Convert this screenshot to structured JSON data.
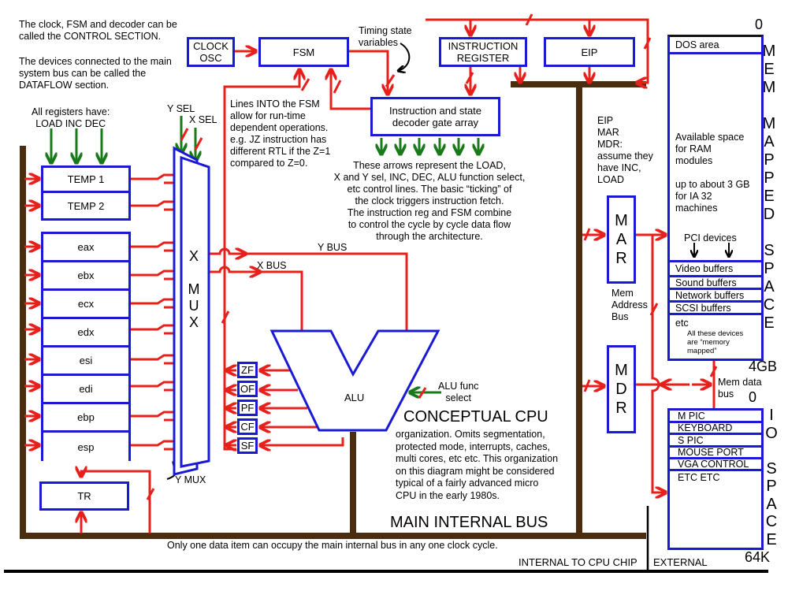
{
  "title": "Conceptual CPU organization diagram",
  "notes": {
    "control_section": "The clock, FSM and decoder can be\ncalled the CONTROL SECTION.",
    "dataflow_section": "The devices connected to the main\nsystem bus can be called the\nDATAFLOW section.",
    "registers_have": "All registers have:\nLOAD  INC  DEC",
    "fsm_lines": "Lines INTO the FSM\nallow for run-time\ndependent operations.\ne.g. JZ instruction has\ndifferent RTL if the Z=1\ncompared to Z=0.",
    "timing_state": "Timing state\nvariables",
    "control_arrows": "These arrows represent the LOAD,\nX and Y sel, INC, DEC, ALU function select,\netc control lines. The basic “ticking” of\nthe clock triggers instruction fetch.\nThe instruction reg and FSM combine\nto control the cycle by cycle data flow\nthrough the architecture.",
    "eip_mar_mdr": "EIP\nMAR\nMDR:\nassume they\nhave INC,\nLOAD",
    "mem_address_bus": "Mem\nAddress\nBus",
    "mem_data_bus": "Mem data\nbus",
    "conceptual_cpu_title": "CONCEPTUAL CPU",
    "conceptual_cpu_body": "organization. Omits segmentation,\nprotected  mode, interrupts, caches,\nmulti cores, etc etc. This organization\non this diagram might be considered\ntypical of a fairly advanced micro\nCPU in the early 1980s.",
    "main_internal_bus": "MAIN INTERNAL BUS",
    "bus_note": "Only one data item can occupy the main internal bus in any one clock cycle.",
    "internal_label": "INTERNAL TO CPU CHIP",
    "external_label": "EXTERNAL"
  },
  "control": {
    "clock": "CLOCK\nOSC",
    "fsm": "FSM",
    "instruction_register": "INSTRUCTION\nREGISTER",
    "eip": "EIP",
    "decoder": "Instruction and state\ndecoder gate array"
  },
  "mux": {
    "y_sel": "Y SEL",
    "x_sel": "X SEL",
    "label": "X\n\nM\nU\nX",
    "y_mux": "Y MUX",
    "x_bus": "X BUS",
    "y_bus": "Y BUS"
  },
  "registers": {
    "temp": [
      "TEMP 1",
      "TEMP 2"
    ],
    "general": [
      "eax",
      "ebx",
      "ecx",
      "edx",
      "esi",
      "edi",
      "ebp",
      "esp"
    ],
    "tr": "TR"
  },
  "alu": {
    "label": "ALU",
    "func_select": "ALU func\nselect",
    "flags": [
      "ZF",
      "OF",
      "PF",
      "CF",
      "SF"
    ]
  },
  "mem_regs": {
    "mar": "M\nA\nR",
    "mdr": "M\nD\nR"
  },
  "memory_map": {
    "start": "0",
    "end": "4GB",
    "side_label": "M\nE\nM\n\nM\nA\nP\nP\nE\nD\n\nS\nP\nA\nC\nE",
    "dos_area": "DOS area",
    "ram_text": "Available space\nfor RAM\nmodules\n\nup to about 3 GB\nfor IA 32\nmachines",
    "pci_devices": "PCI devices",
    "buffers": [
      "Video buffers",
      "Sound buffers",
      "Network buffers",
      "SCSI buffers"
    ],
    "etc": "etc",
    "etc_note": "All these devices\nare “memory\nmapped”"
  },
  "io_map": {
    "start": "0",
    "end": "64K",
    "side_label": "I\nO\n\nS\nP\nA\nC\nE",
    "ports": [
      "M PIC",
      "KEYBOARD",
      "S PIC",
      "MOUSE PORT",
      "VGA CONTROL"
    ],
    "etc": "ETC ETC"
  },
  "colors": {
    "box_border": "#1a1ad4",
    "signal_red": "#e8201c",
    "control_green": "#1a7a1a",
    "bus_brown": "#4a2c0e"
  }
}
